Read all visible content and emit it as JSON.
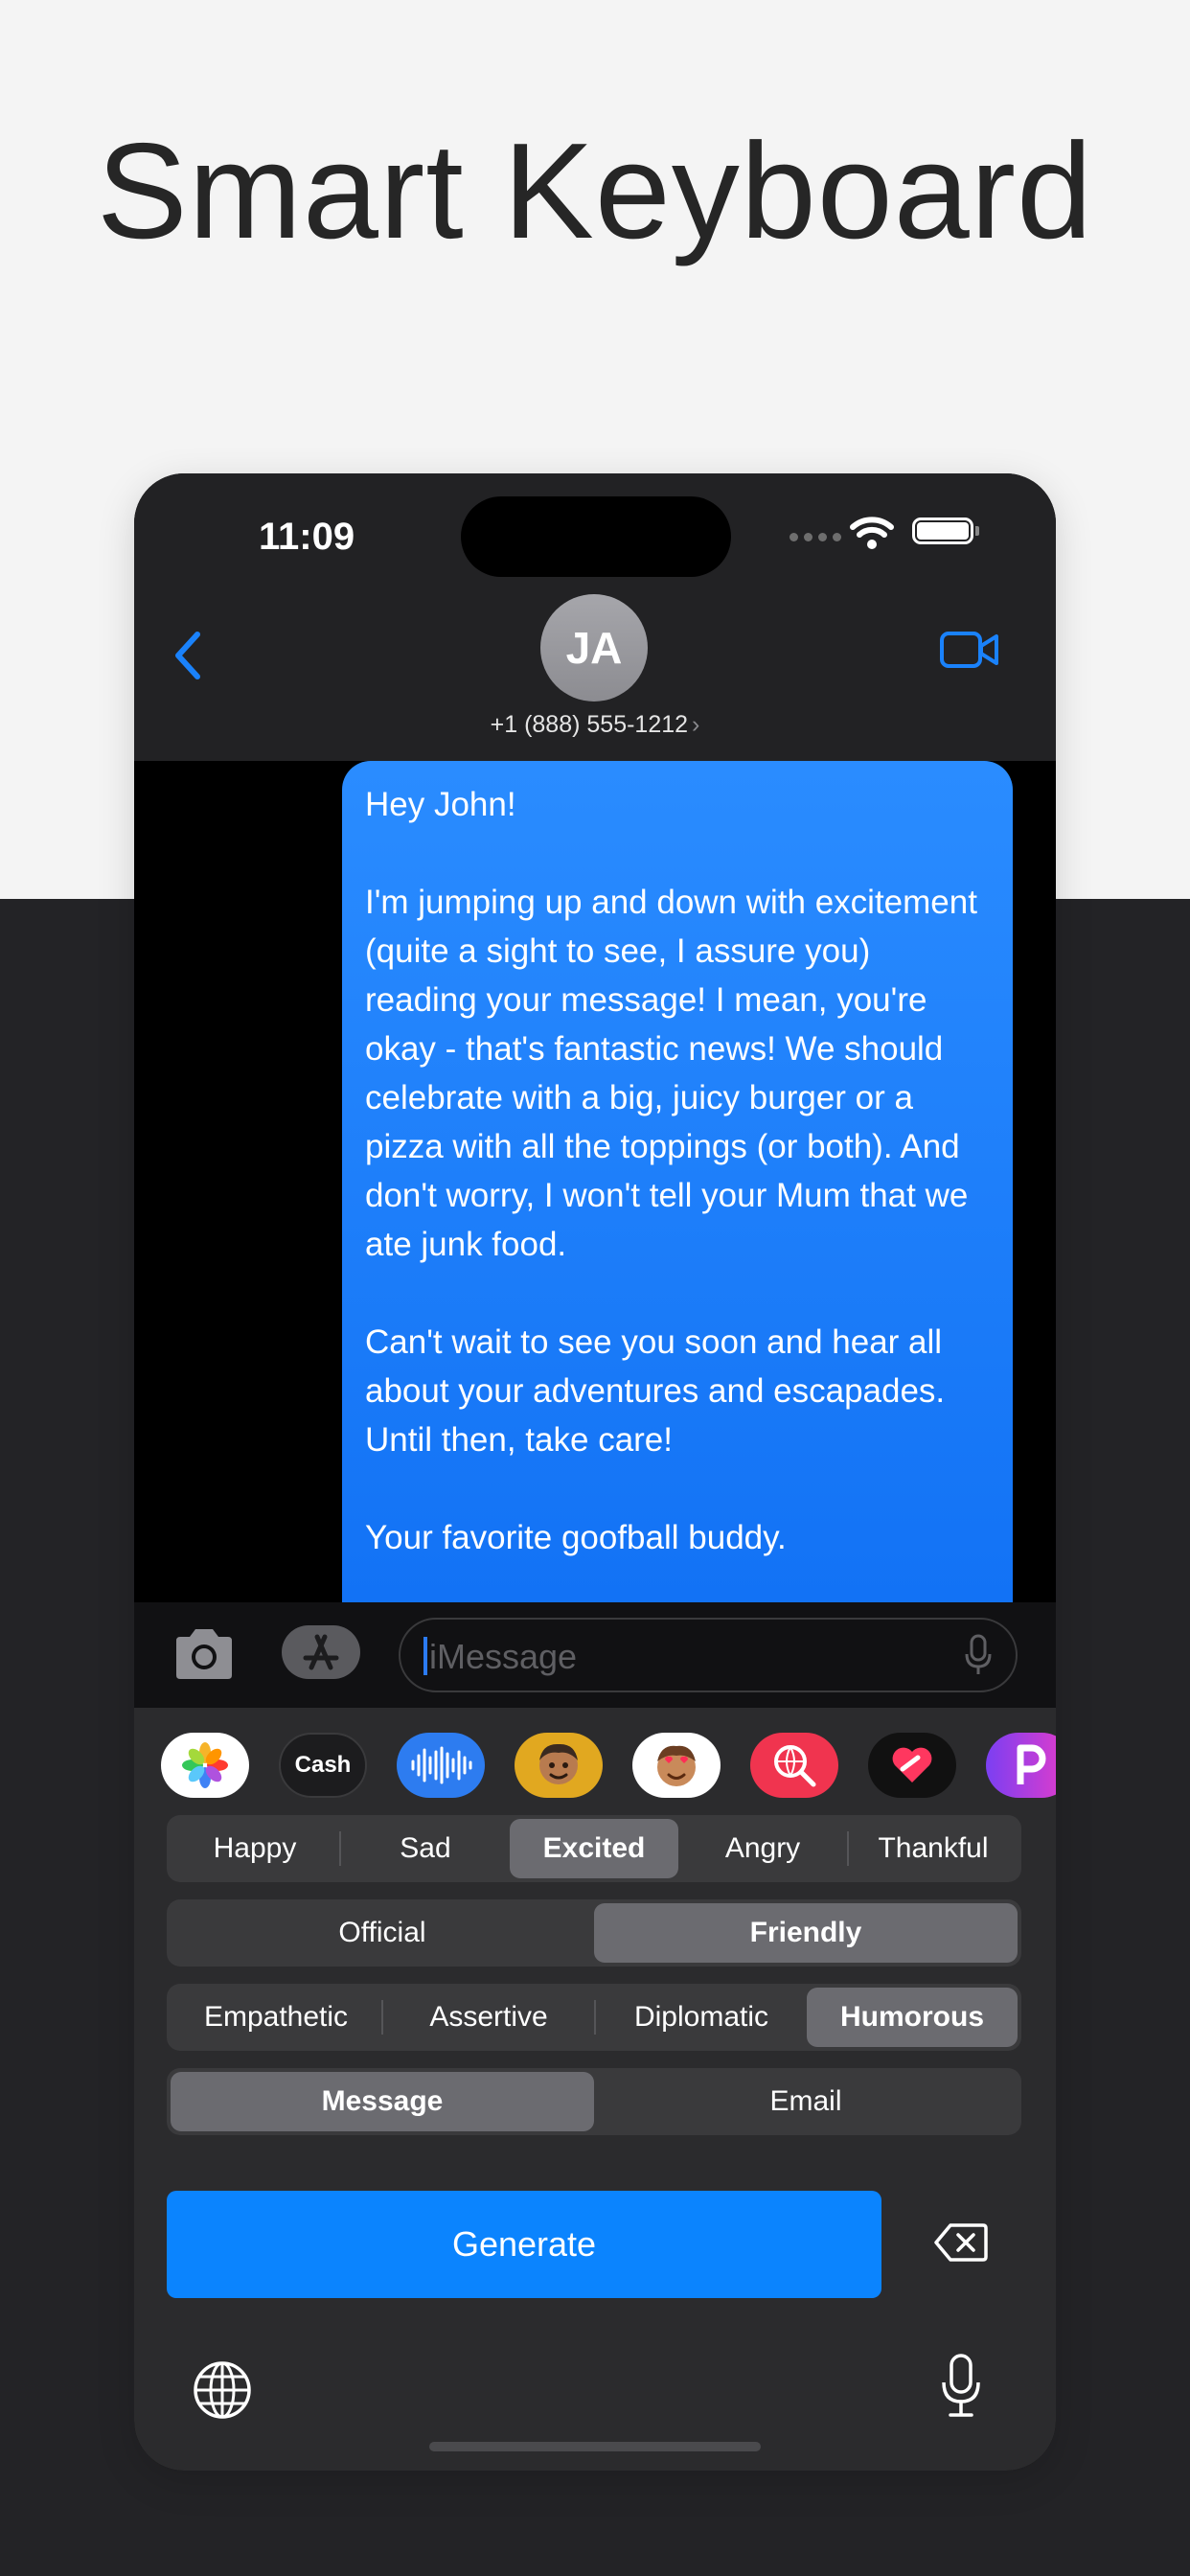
{
  "headline": "Smart Keyboard",
  "status": {
    "time": "11:09"
  },
  "contact": {
    "initials": "JA",
    "phone": "+1 (888) 555-1212",
    "chevron": "›"
  },
  "message": {
    "text": "Hey John!\n\nI'm jumping up and down with excitement (quite a sight to see, I assure you) reading your message! I mean, you're okay - that's fantastic news! We should celebrate with a big, juicy burger or a pizza with all the toppings (or both). And don't worry, I won't tell your Mum that we ate junk food.\n\nCan't wait to see you soon and hear all about your adventures and escapades. Until then, take care!\n\nYour favorite goofball buddy."
  },
  "input": {
    "placeholder": "iMessage"
  },
  "apps": {
    "cash_label": "Cash"
  },
  "keyboard": {
    "moods": [
      {
        "label": "Happy",
        "selected": false
      },
      {
        "label": "Sad",
        "selected": false
      },
      {
        "label": "Excited",
        "selected": true
      },
      {
        "label": "Angry",
        "selected": false
      },
      {
        "label": "Thankful",
        "selected": false
      }
    ],
    "formality": [
      {
        "label": "Official",
        "selected": false
      },
      {
        "label": "Friendly",
        "selected": true
      }
    ],
    "tones": [
      {
        "label": "Empathetic",
        "selected": false
      },
      {
        "label": "Assertive",
        "selected": false
      },
      {
        "label": "Diplomatic",
        "selected": false
      },
      {
        "label": "Humorous",
        "selected": true
      }
    ],
    "formats": [
      {
        "label": "Message",
        "selected": true
      },
      {
        "label": "Email",
        "selected": false
      }
    ],
    "generate_label": "Generate"
  },
  "colors": {
    "accent": "#0b84fe",
    "bubble": "#1a7ff8",
    "keyboard_bg": "#2b2b2d"
  }
}
